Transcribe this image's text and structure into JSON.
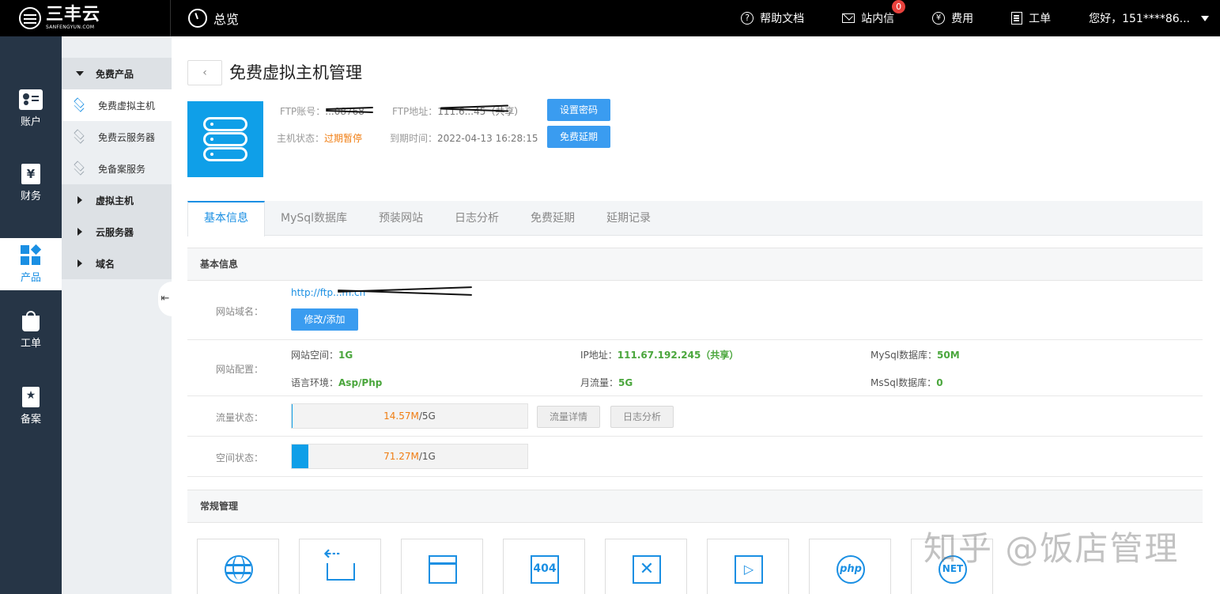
{
  "logo": {
    "main": "三丰云",
    "sub": "SANFENGYUN.COM"
  },
  "topbar": {
    "overview": "总览",
    "help": "帮助文档",
    "messages": "站内信",
    "messages_badge": "0",
    "fees": "费用",
    "tickets": "工单",
    "user": "您好，151****86..."
  },
  "leftnav": {
    "account": "账户",
    "finance": "财务",
    "finance_symbol": "¥",
    "product": "产品",
    "ticket": "工单",
    "record": "备案"
  },
  "subnav": {
    "free_group": "免费产品",
    "free_vhost": "免费虚拟主机",
    "free_cloud": "免费云服务器",
    "free_record": "免备案服务",
    "vhost": "虚拟主机",
    "cloud": "云服务器",
    "domain": "域名",
    "collapse": "⇤"
  },
  "page": {
    "back": "‹",
    "title": "免费虚拟主机管理",
    "ftp_account_label": "FTP账号：",
    "ftp_account_value": "...08768",
    "ftp_address_label": "FTP地址：",
    "ftp_address_value": "111.6...45（共享）",
    "set_password": "设置密码",
    "host_status_label": "主机状态：",
    "host_status_value": "过期暂停",
    "expire_label": "到期时间：",
    "expire_value": "2022-04-13 16:28:15",
    "free_extend": "免费延期"
  },
  "tabs": [
    "基本信息",
    "MySql数据库",
    "预装网站",
    "日志分析",
    "免费延期",
    "延期记录"
  ],
  "basic": {
    "section_title": "基本信息",
    "domain_label": "网站域名：",
    "domain_link": "http://ftp...m.cn",
    "modify_button": "修改/添加",
    "config_label": "网站配置：",
    "space_label": "网站空间：",
    "space_value": "1G",
    "ip_label": "IP地址：",
    "ip_value": "111.67.192.245（共享）",
    "mysql_label": "MySql数据库：",
    "mysql_value": "50M",
    "lang_label": "语言环境：",
    "lang_value": "Asp/Php",
    "traffic_month_label": "月流量：",
    "traffic_month_value": "5G",
    "mssql_label": "MsSql数据库：",
    "mssql_value": "0",
    "traffic_status_label": "流量状态：",
    "traffic_used": "14.57M",
    "traffic_total": "/5G",
    "traffic_fraction": 0.003,
    "traffic_detail_btn": "流量详情",
    "log_btn": "日志分析",
    "space_status_label": "空间状态：",
    "space_used": "71.27M",
    "space_total": "/1G",
    "space_fraction": 0.07
  },
  "general": {
    "section_title": "常规管理",
    "tools": [
      {
        "name": "globe-icon",
        "text": ""
      },
      {
        "name": "redirect-icon",
        "text": ""
      },
      {
        "name": "window-icon",
        "text": ""
      },
      {
        "name": "404-icon",
        "text": "404"
      },
      {
        "name": "close-icon",
        "text": "✕"
      },
      {
        "name": "play-icon",
        "text": "▷"
      },
      {
        "name": "php-icon",
        "text": "php"
      },
      {
        "name": "net-icon",
        "text": "NET"
      }
    ]
  },
  "watermark": "知乎 @饭店管理",
  "colors": {
    "accent": "#1a8fe3",
    "tile": "#0f9fe8",
    "orange": "#f07d12",
    "green": "#4aa63c",
    "nav": "#263546"
  }
}
